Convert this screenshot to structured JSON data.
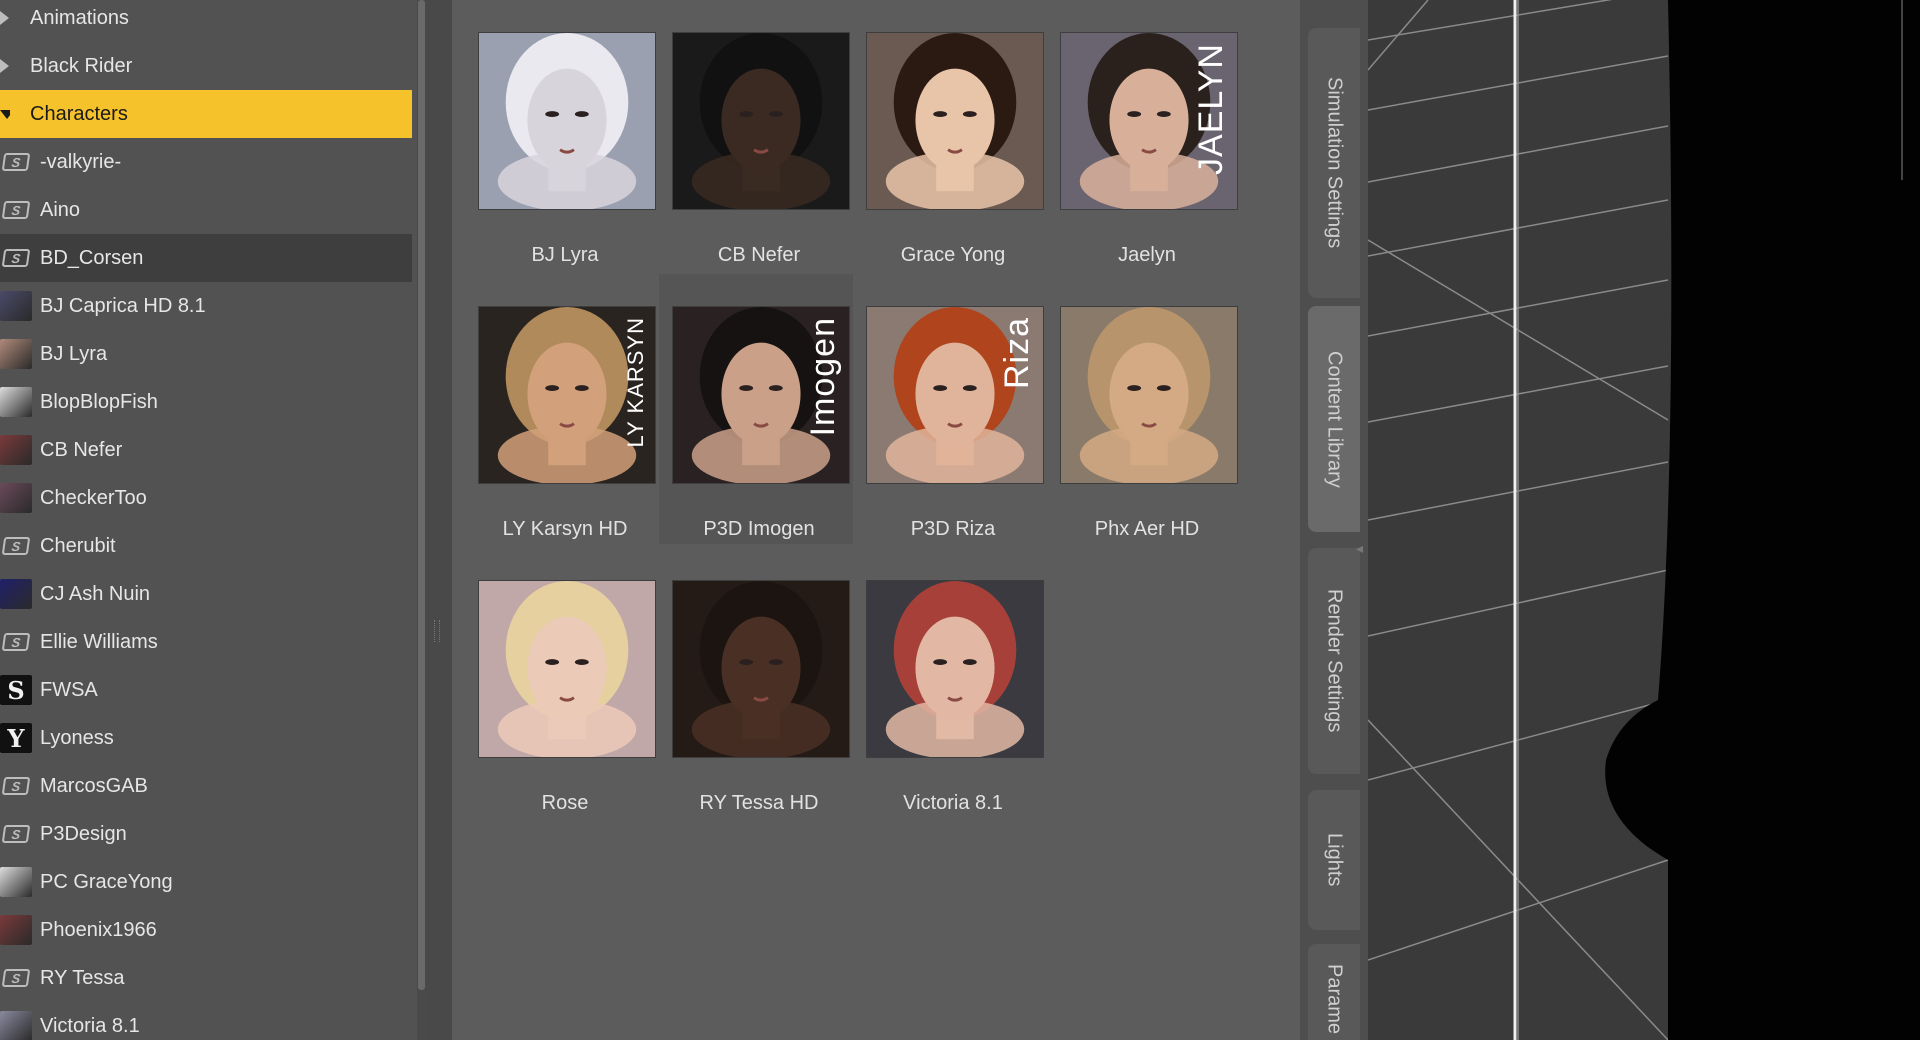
{
  "tree": {
    "items": [
      {
        "label": "Animations",
        "icon": "caret-right-icon",
        "kind": "top"
      },
      {
        "label": "Black Rider",
        "icon": "caret-right-icon",
        "kind": "top"
      },
      {
        "label": "Characters",
        "icon": "caret-down-icon",
        "kind": "top",
        "selected": true
      },
      {
        "label": "-valkyrie-",
        "icon": "folder-icon",
        "kind": "child"
      },
      {
        "label": "Aino",
        "icon": "folder-icon",
        "kind": "child"
      },
      {
        "label": "BD_Corsen",
        "icon": "folder-icon",
        "kind": "child",
        "hovered": true
      },
      {
        "label": "BJ Caprica HD 8.1",
        "icon": "thumbnail-icon",
        "kind": "child"
      },
      {
        "label": "BJ Lyra",
        "icon": "thumbnail-icon",
        "kind": "child"
      },
      {
        "label": "BlopBlopFish",
        "icon": "thumbnail-icon",
        "kind": "child"
      },
      {
        "label": "CB Nefer",
        "icon": "thumbnail-icon",
        "kind": "child"
      },
      {
        "label": "CheckerToo",
        "icon": "thumbnail-icon",
        "kind": "child"
      },
      {
        "label": "Cherubit",
        "icon": "folder-icon",
        "kind": "child"
      },
      {
        "label": "CJ Ash Nuin",
        "icon": "thumbnail-icon",
        "kind": "child"
      },
      {
        "label": "Ellie Williams",
        "icon": "folder-icon",
        "kind": "child"
      },
      {
        "label": "FWSA",
        "icon": "logo-icon",
        "kind": "child",
        "glyph": "S"
      },
      {
        "label": "Lyoness",
        "icon": "logo-icon",
        "kind": "child",
        "glyph": "Y"
      },
      {
        "label": "MarcosGAB",
        "icon": "folder-icon",
        "kind": "child"
      },
      {
        "label": "P3Design",
        "icon": "folder-icon",
        "kind": "child"
      },
      {
        "label": "PC GraceYong",
        "icon": "thumbnail-icon",
        "kind": "child"
      },
      {
        "label": "Phoenix1966",
        "icon": "thumbnail-icon",
        "kind": "child"
      },
      {
        "label": "RY Tessa",
        "icon": "folder-icon",
        "kind": "child"
      },
      {
        "label": "Victoria 8.1",
        "icon": "thumbnail-icon",
        "kind": "child"
      }
    ],
    "folder_glyph": "S"
  },
  "grid": {
    "tiles": [
      {
        "label": "BJ Lyra",
        "skin": "#d8d4dc",
        "hair": "#e9e9ef",
        "bg": "#9aa0b0"
      },
      {
        "label": "CB Nefer",
        "skin": "#3a2a22",
        "hair": "#111111",
        "bg": "#1a1a1a"
      },
      {
        "label": "Grace Yong",
        "skin": "#e8c4a8",
        "hair": "#2a1a12",
        "bg": "#6a5a52"
      },
      {
        "label": "Jaelyn",
        "skin": "#d8b09a",
        "hair": "#2a201c",
        "bg": "#6a6470",
        "overlay": "JAELYN"
      },
      {
        "label": "LY Karsyn HD",
        "skin": "#d2a07a",
        "hair": "#b08a5a",
        "bg": "#2a2420",
        "overlay": "LY KARSYN"
      },
      {
        "label": "P3D Imogen",
        "skin": "#caa088",
        "hair": "#161212",
        "bg": "#2a2222",
        "overlay": "Imogen",
        "hovered": true
      },
      {
        "label": "P3D Riza",
        "skin": "#e0b49a",
        "hair": "#b0441c",
        "bg": "#8a7a72",
        "overlay": "Riza"
      },
      {
        "label": "Phx Aer HD",
        "skin": "#d4aa84",
        "hair": "#b8946c",
        "bg": "#8a7a6a"
      },
      {
        "label": "Rose",
        "skin": "#eccab8",
        "hair": "#e6d0a0",
        "bg": "#c0a8a8"
      },
      {
        "label": "RY Tessa HD",
        "skin": "#4a3024",
        "hair": "#1c1410",
        "bg": "#241a16"
      },
      {
        "label": "Victoria 8.1",
        "skin": "#e2b8a4",
        "hair": "#a8403a",
        "bg": "#3a3a40"
      }
    ]
  },
  "side_tabs": [
    {
      "label": "Simulation Settings"
    },
    {
      "label": "Content Library",
      "active": true
    },
    {
      "label": "Render Settings"
    },
    {
      "label": "Lights"
    },
    {
      "label": "Parame"
    }
  ],
  "colors": {
    "selection": "#f6c22c",
    "panel": "#525252",
    "grid_bg": "#5c5c5c",
    "viewport_bg": "#3a3a3a"
  }
}
